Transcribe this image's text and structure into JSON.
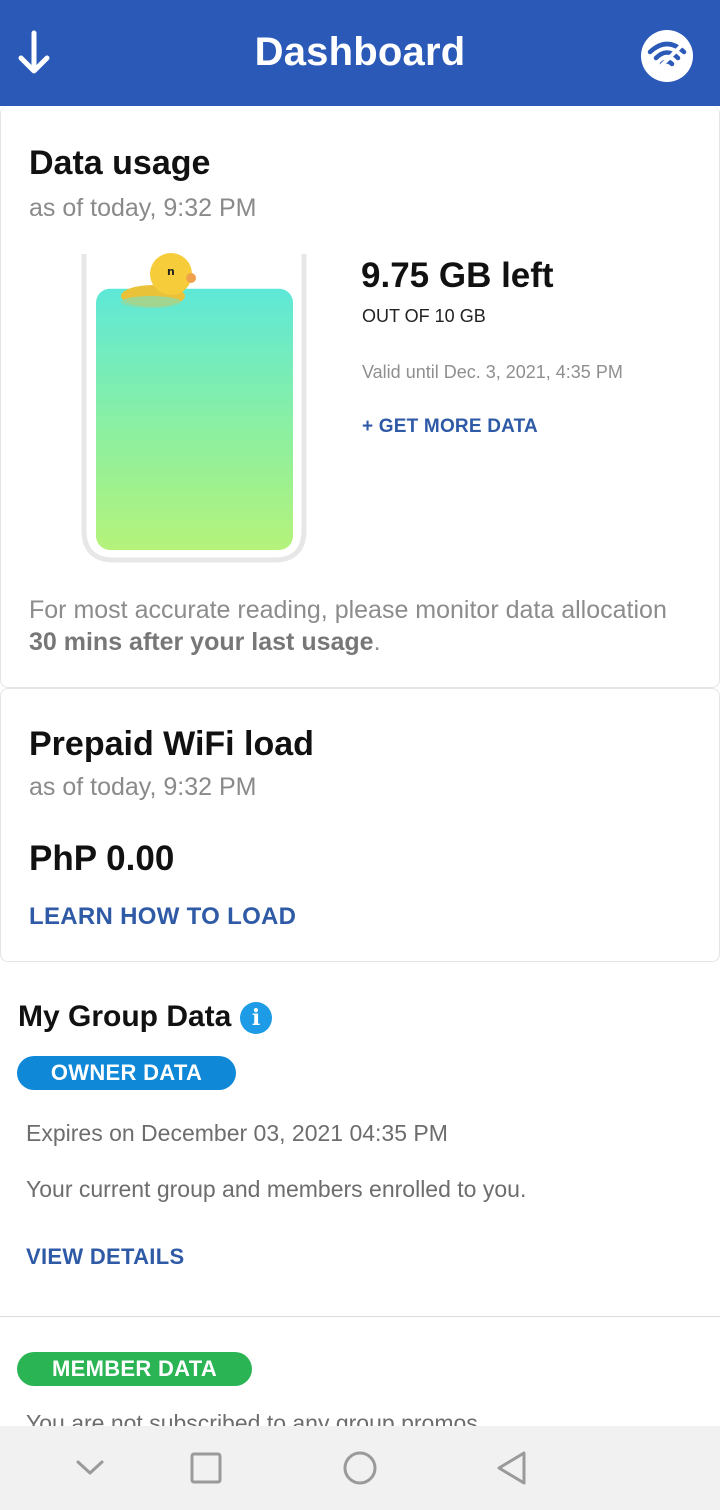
{
  "header": {
    "title": "Dashboard",
    "back_icon": "download-arrow-icon",
    "action_icon": "wifi-icon",
    "color": "#2a59b8"
  },
  "data_usage": {
    "title": "Data usage",
    "as_of": "as of today, 9:32 PM",
    "remaining": "9.75 GB left",
    "out_of": "OUT OF 10 GB",
    "valid_until": "Valid until Dec. 3, 2021, 4:35 PM",
    "get_more": "+ GET MORE DATA",
    "fill_fraction": 0.975,
    "note_prefix": "For most accurate reading, please monitor data allocation ",
    "note_bold": "30 mins after your last usage",
    "note_suffix": "."
  },
  "prepaid_load": {
    "title": "Prepaid WiFi load",
    "as_of": "as of today, 9:32 PM",
    "balance": "PhP 0.00",
    "learn_link": "LEARN HOW TO LOAD"
  },
  "group_data": {
    "title": "My Group Data",
    "info_icon": "i",
    "owner_badge": "OWNER DATA",
    "expires": "Expires on December 03, 2021 04:35 PM",
    "description": "Your current group and members enrolled to you.",
    "view_details": "VIEW DETAILS",
    "member_badge": "MEMBER DATA",
    "member_text": "You are not subscribed to any group promos"
  },
  "navbar": {
    "icons": [
      "chevron-down-icon",
      "recents-square-icon",
      "home-circle-icon",
      "back-triangle-icon"
    ]
  }
}
